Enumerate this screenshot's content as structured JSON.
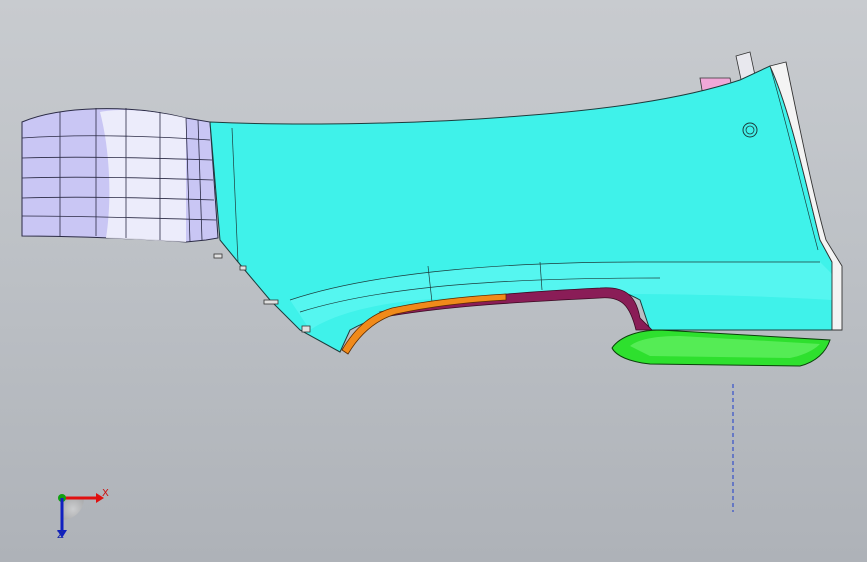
{
  "viewport": {
    "background_top": "#c8cbcf",
    "background_bottom": "#aeb2b8"
  },
  "model": {
    "parts": [
      {
        "name": "main-panel",
        "color": "#3ff2ea"
      },
      {
        "name": "end-block",
        "color": "#b9b6ee"
      },
      {
        "name": "lower-trim",
        "color": "#2ee02e"
      },
      {
        "name": "arch-strip",
        "color": "#f08a1a"
      },
      {
        "name": "inner-arch",
        "color": "#8a1d57"
      },
      {
        "name": "rear-edge",
        "color": "#f4f4f4"
      },
      {
        "name": "top-tab",
        "color": "#f0a8d8"
      }
    ]
  },
  "triad": {
    "x_label": "X",
    "z_label": "Z",
    "x_color": "#e01010",
    "y_color": "#10a010",
    "z_color": "#1020c0"
  }
}
